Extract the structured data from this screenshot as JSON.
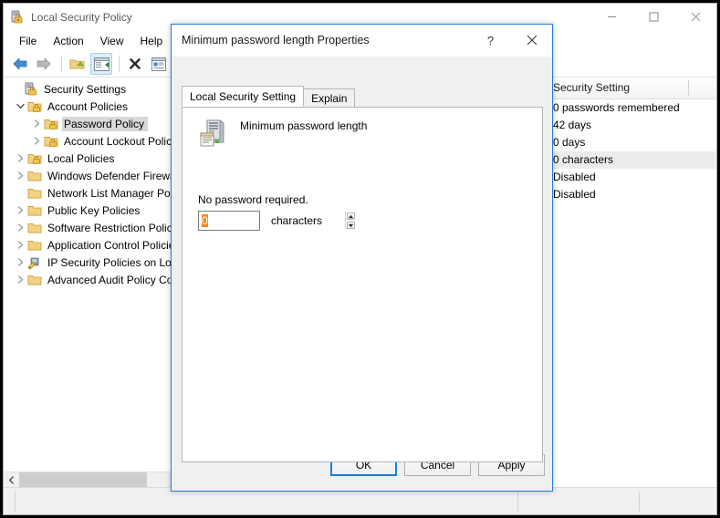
{
  "window": {
    "title": "Local Security Policy",
    "icon": "security-policy-icon",
    "controls": {
      "minimize": "minimize-icon",
      "maximize": "maximize-icon",
      "close": "close-icon"
    }
  },
  "menubar": {
    "items": [
      {
        "label": "File"
      },
      {
        "label": "Action"
      },
      {
        "label": "View"
      },
      {
        "label": "Help"
      }
    ]
  },
  "toolbar": {
    "buttons": [
      {
        "name": "back-icon"
      },
      {
        "name": "forward-icon"
      },
      {
        "name": "up-folder-icon"
      },
      {
        "name": "show-hide-console-tree-icon",
        "active": true
      },
      {
        "name": "delete-icon"
      },
      {
        "name": "properties-icon"
      },
      {
        "name": "export-list-icon"
      }
    ]
  },
  "tree": {
    "items": [
      {
        "label": "Security Settings",
        "depth": 0,
        "twisty": "none",
        "icon": "security-settings-icon",
        "selected": false
      },
      {
        "label": "Account Policies",
        "depth": 1,
        "twisty": "expanded",
        "icon": "folder-lock-icon",
        "selected": false
      },
      {
        "label": "Password Policy",
        "depth": 2,
        "twisty": "collapsed",
        "icon": "folder-lock-icon",
        "selected": true
      },
      {
        "label": "Account Lockout Policy",
        "depth": 2,
        "twisty": "collapsed",
        "icon": "folder-lock-icon",
        "selected": false
      },
      {
        "label": "Local Policies",
        "depth": 1,
        "twisty": "collapsed",
        "icon": "folder-lock-icon",
        "selected": false
      },
      {
        "label": "Windows Defender Firewall with",
        "depth": 1,
        "twisty": "collapsed",
        "icon": "folder-icon",
        "selected": false
      },
      {
        "label": "Network List Manager Policies",
        "depth": 1,
        "twisty": "none",
        "icon": "folder-icon",
        "selected": false
      },
      {
        "label": "Public Key Policies",
        "depth": 1,
        "twisty": "collapsed",
        "icon": "folder-icon",
        "selected": false
      },
      {
        "label": "Software Restriction Policies",
        "depth": 1,
        "twisty": "collapsed",
        "icon": "folder-icon",
        "selected": false
      },
      {
        "label": "Application Control Policies",
        "depth": 1,
        "twisty": "collapsed",
        "icon": "folder-icon",
        "selected": false
      },
      {
        "label": "IP Security Policies on Local C",
        "depth": 1,
        "twisty": "collapsed",
        "icon": "ip-security-icon",
        "selected": false
      },
      {
        "label": "Advanced Audit Policy Config",
        "depth": 1,
        "twisty": "collapsed",
        "icon": "folder-icon",
        "selected": false
      }
    ]
  },
  "list": {
    "columns": [
      {
        "label": "Security Setting"
      }
    ],
    "rows": [
      {
        "value": "0 passwords remembered",
        "selected": false
      },
      {
        "value": "42 days",
        "selected": false
      },
      {
        "value": "0 days",
        "selected": false
      },
      {
        "value": "0 characters",
        "selected": true
      },
      {
        "value": "Disabled",
        "selected": false
      },
      {
        "value": "Disabled",
        "selected": false
      }
    ]
  },
  "statusbar": {
    "pane1": "",
    "pane2": "",
    "pane3": ""
  },
  "dialog": {
    "title": "Minimum password length Properties",
    "help_label": "?",
    "close_label": "✕",
    "tabs": [
      {
        "label": "Local Security Setting",
        "active": true
      },
      {
        "label": "Explain",
        "active": false
      }
    ],
    "policy_icon": "policy-server-icon",
    "policy_name": "Minimum password length",
    "hint": "No password required.",
    "spinner": {
      "value": "0",
      "placeholder": "0",
      "up_label": "▲",
      "down_label": "▼"
    },
    "unit": "characters",
    "buttons": {
      "ok": "OK",
      "cancel": "Cancel",
      "apply": "Apply"
    }
  },
  "colors": {
    "accent": "#2b7cd3",
    "selection": "#d8d8d8",
    "list_selection": "#ececec",
    "folder": "#f5c65a",
    "default_button_border": "#1a7fd4"
  }
}
